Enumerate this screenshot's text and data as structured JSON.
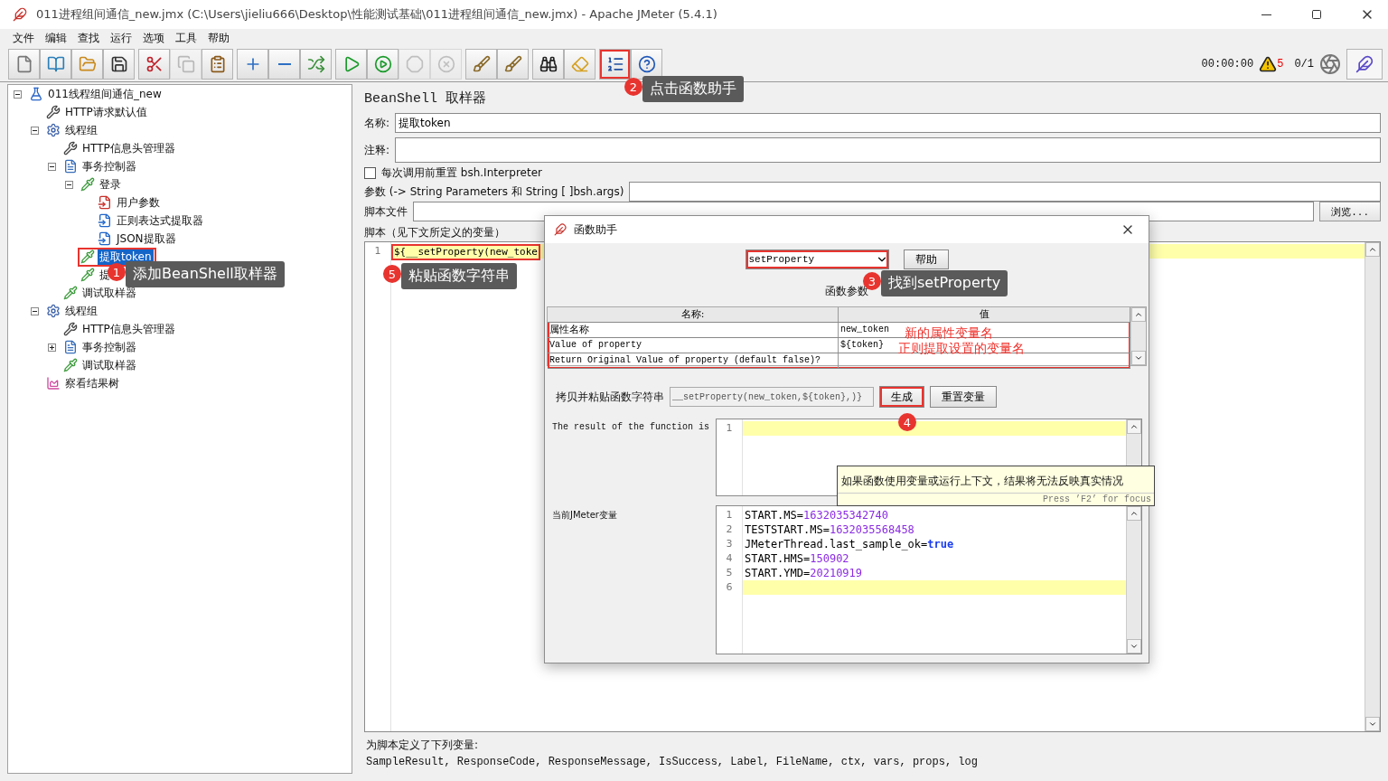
{
  "window": {
    "title": "011进程组间通信_new.jmx (C:\\Users\\jieliu666\\Desktop\\性能测试基础\\011进程组间通信_new.jmx) - Apache JMeter (5.4.1)"
  },
  "menu": [
    "文件",
    "编辑",
    "查找",
    "运行",
    "选项",
    "工具",
    "帮助"
  ],
  "toolbar": {
    "groups": [
      [
        {
          "disabled": false,
          "highlighted": false
        },
        {
          "disabled": false,
          "highlighted": false
        },
        {
          "disabled": false,
          "highlighted": false
        },
        {
          "disabled": false,
          "highlighted": false
        }
      ],
      [
        {
          "disabled": false,
          "highlighted": false
        },
        {
          "disabled": true,
          "highlighted": false
        },
        {
          "disabled": false,
          "highlighted": false
        }
      ],
      [
        {
          "disabled": false,
          "highlighted": false
        },
        {
          "disabled": false,
          "highlighted": false
        },
        {
          "disabled": false,
          "highlighted": false
        }
      ],
      [
        {
          "disabled": false,
          "highlighted": false
        },
        {
          "disabled": false,
          "highlighted": false
        },
        {
          "disabled": true,
          "highlighted": false
        },
        {
          "disabled": true,
          "highlighted": false
        }
      ],
      [
        {
          "disabled": false,
          "highlighted": false
        },
        {
          "disabled": false,
          "highlighted": false
        }
      ],
      [
        {
          "disabled": false,
          "highlighted": false
        },
        {
          "disabled": false,
          "highlighted": false
        }
      ],
      [
        {
          "disabled": false,
          "highlighted": true
        },
        {
          "disabled": false,
          "highlighted": false
        }
      ]
    ]
  },
  "status": {
    "timer": "00:00:00",
    "warnings": "5",
    "threads": "0/1"
  },
  "tree": {
    "label": "011线程组间通信_new",
    "kind": "test-plan",
    "expanded": true,
    "selected": false,
    "highlighted": false,
    "children": [
      {
        "label": "HTTP请求默认值",
        "kind": "config",
        "selected": false,
        "highlighted": false
      },
      {
        "label": "线程组",
        "kind": "thread-group",
        "expanded": true,
        "selected": false,
        "highlighted": false,
        "children": [
          {
            "label": "HTTP信息头管理器",
            "kind": "config",
            "selected": false,
            "highlighted": false
          },
          {
            "label": "事务控制器",
            "kind": "controller",
            "expanded": true,
            "selected": false,
            "highlighted": false,
            "children": [
              {
                "label": "登录",
                "kind": "sampler",
                "expanded": true,
                "selected": false,
                "highlighted": false,
                "children": [
                  {
                    "label": "用户参数",
                    "kind": "preprocessor",
                    "selected": false,
                    "highlighted": false
                  },
                  {
                    "label": "正则表达式提取器",
                    "kind": "extractor",
                    "selected": false,
                    "highlighted": false
                  },
                  {
                    "label": "JSON提取器",
                    "kind": "extractor",
                    "selected": false,
                    "highlighted": false
                  }
                ]
              },
              {
                "label": "提取token",
                "kind": "sampler",
                "selected": true,
                "highlighted": true
              },
              {
                "label": "提",
                "kind": "sampler",
                "selected": false,
                "highlighted": false
              }
            ]
          },
          {
            "label": "调试取样器",
            "kind": "sampler",
            "selected": false,
            "highlighted": false
          }
        ]
      },
      {
        "label": "线程组",
        "kind": "thread-group",
        "expanded": true,
        "selected": false,
        "highlighted": false,
        "children": [
          {
            "label": "HTTP信息头管理器",
            "kind": "config",
            "selected": false,
            "highlighted": false
          },
          {
            "label": "事务控制器",
            "kind": "controller",
            "expanded": false,
            "selected": false,
            "highlighted": false
          },
          {
            "label": "调试取样器",
            "kind": "sampler",
            "selected": false,
            "highlighted": false
          }
        ]
      },
      {
        "label": "察看结果树",
        "kind": "listener",
        "selected": false,
        "highlighted": false
      }
    ]
  },
  "panel": {
    "title": "BeanShell 取样器",
    "name_label": "名称:",
    "name_value": "提取token",
    "comment_label": "注释:",
    "reset_checkbox": {
      "label": "每次调用前重置 bsh.Interpreter",
      "checked": false
    },
    "params_label": "参数 (-> String Parameters 和 String [ ]bsh.args)",
    "file_label": "脚本文件",
    "browse_button": "浏览...",
    "script_label": "脚本（见下文所定义的变量）",
    "script": [
      {
        "number": "1",
        "text": "${__setProperty(new_toke",
        "highlighted": true
      }
    ],
    "vars_title": "为脚本定义了下列变量:",
    "vars_list": "SampleResult, ResponseCode, ResponseMessage, IsSuccess, Label, FileName, ctx, vars, props, log"
  },
  "dialog": {
    "title": "函数助手",
    "function": {
      "value": "setProperty",
      "highlighted": true
    },
    "help_button": "帮助",
    "params_title": "函数参数",
    "table": {
      "columns": [
        "名称:",
        "值"
      ],
      "highlighted": true,
      "rows": [
        {
          "name": "属性名称",
          "value": "new_token"
        },
        {
          "name": "Value of property",
          "value": "${token}"
        },
        {
          "name": "Return Original Value of property (default false)?"
        }
      ]
    },
    "notes": [
      "新的属性变量名",
      "正则提取设置的变量名"
    ],
    "copy_label": "拷贝并粘贴函数字符串",
    "copy_value": "__setProperty(new_token,${token},)}",
    "generate_button": {
      "label": "生成",
      "highlighted": true
    },
    "reset_button": "重置变量",
    "result_label": "The result of the function is",
    "result": [
      {
        "number": "1",
        "current": true
      }
    ],
    "tooltip": {
      "text": "如果函数使用变量或运行上下文，结果将无法反映真实情况",
      "hint": "Press ’F2’ for focus"
    },
    "vars_label": "当前JMeter变量",
    "vars": [
      {
        "number": "1",
        "key": "START.MS=",
        "value": "1632035342740",
        "kind": "number",
        "current": false
      },
      {
        "number": "2",
        "key": "TESTSTART.MS=",
        "value": "1632035568458",
        "kind": "number",
        "current": false
      },
      {
        "number": "3",
        "key": "JMeterThread.last_sample_ok=",
        "value": "true",
        "kind": "boolean",
        "current": false
      },
      {
        "number": "4",
        "key": "START.HMS=",
        "value": "150902",
        "kind": "number",
        "current": false
      },
      {
        "number": "5",
        "key": "START.YMD=",
        "value": "20210919",
        "kind": "number",
        "current": false
      },
      {
        "number": "6",
        "current": true
      }
    ]
  },
  "callouts": [
    {
      "number": "2",
      "text": "点击函数助手"
    },
    {
      "number": "1",
      "text": "添加BeanShell取样器"
    },
    {
      "number": "5",
      "text": "粘贴函数字符串"
    },
    {
      "number": "3",
      "text": "找到setProperty"
    },
    {
      "number": "4"
    }
  ]
}
